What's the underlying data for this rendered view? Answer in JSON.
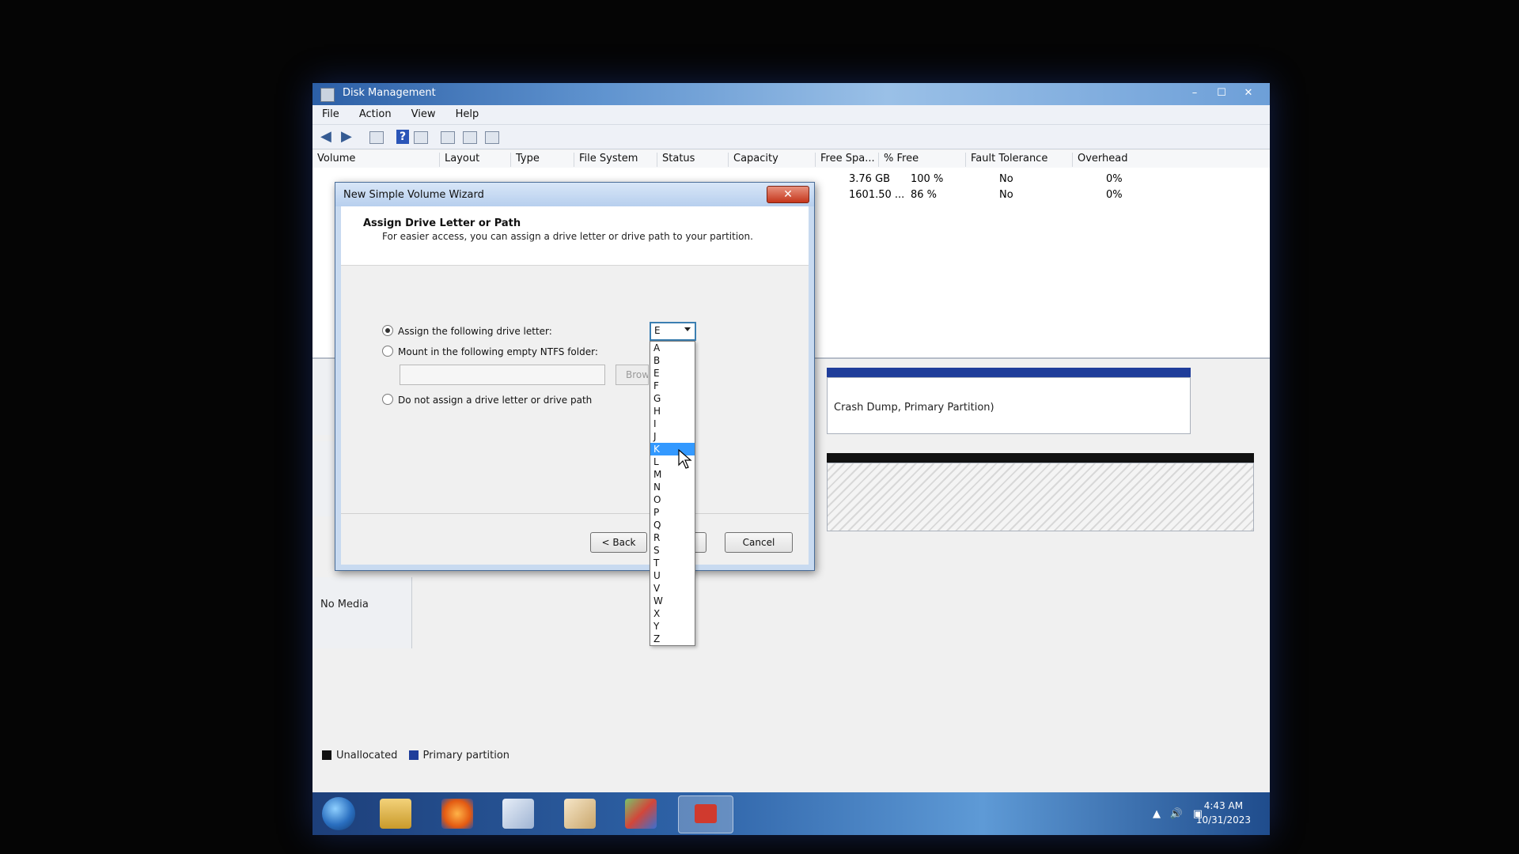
{
  "main_window": {
    "title": "Disk Management",
    "controls": {
      "minimize": "–",
      "maximize": "☐",
      "close": "✕"
    },
    "menu": [
      "File",
      "Action",
      "View",
      "Help"
    ],
    "columns": [
      "Volume",
      "Layout",
      "Type",
      "File System",
      "Status",
      "Capacity",
      "Free Spa...",
      "% Free",
      "Fault Tolerance",
      "Overhead"
    ],
    "rows": [
      {
        "free_space": "3.76 GB",
        "pct_free": "100 %",
        "fault_tolerance": "No",
        "overhead": "0%"
      },
      {
        "free_space": "1601.50 ...",
        "pct_free": "86 %",
        "fault_tolerance": "No",
        "overhead": "0%"
      }
    ],
    "partition_text": "Crash Dump, Primary Partition)",
    "no_media": "No Media",
    "legend": {
      "unallocated": "Unallocated",
      "primary": "Primary partition"
    },
    "colors": {
      "unallocated": "#111111",
      "primary": "#1f3d9a"
    }
  },
  "wizard": {
    "title": "New Simple Volume Wizard",
    "close_label": "✕",
    "heading": "Assign Drive Letter or Path",
    "subheading": "For easier access, you can assign a drive letter or drive path to your partition.",
    "option_assign": "Assign the following drive letter:",
    "option_mount": "Mount in the following empty NTFS folder:",
    "option_none": "Do not assign a drive letter or drive path",
    "browse_label": "Browse...",
    "back_label": "< Back",
    "next_label": "Next >",
    "cancel_label": "Cancel",
    "selected_letter": "E",
    "letters": [
      "A",
      "B",
      "E",
      "F",
      "G",
      "H",
      "I",
      "J",
      "K",
      "L",
      "M",
      "N",
      "O",
      "P",
      "Q",
      "R",
      "S",
      "T",
      "U",
      "V",
      "W",
      "X",
      "Y",
      "Z"
    ],
    "highlighted_letter": "K"
  },
  "taskbar": {
    "time": "4:43 AM",
    "date": "10/31/2023",
    "tray_arrow": "▲",
    "volume_icon": "🔊",
    "network_icon": "▣"
  }
}
